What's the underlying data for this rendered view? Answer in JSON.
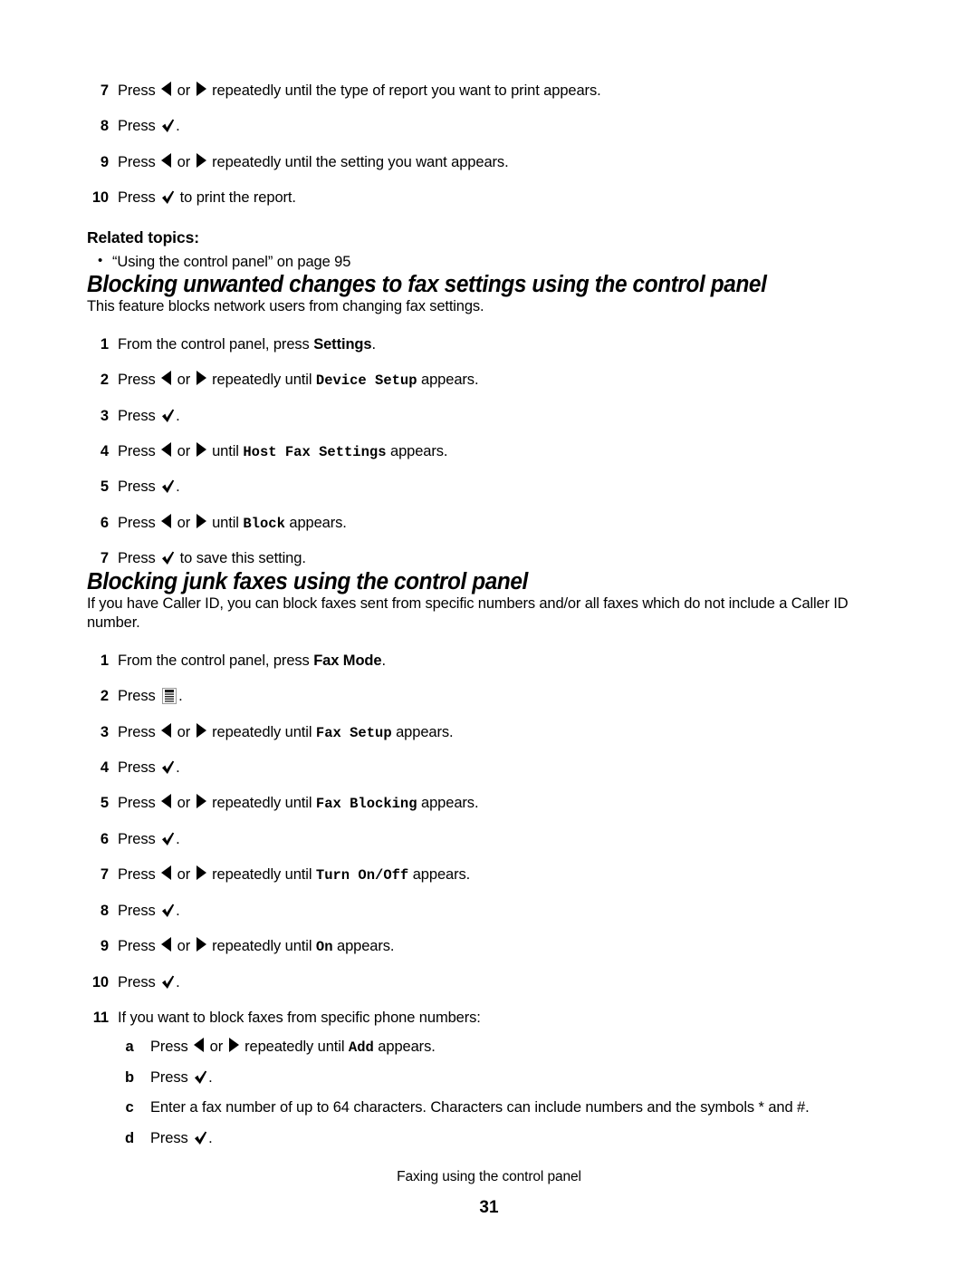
{
  "page": {
    "number": "31",
    "footer_title": "Faxing using the control panel"
  },
  "top_steps": [
    {
      "num": "7",
      "pre": "Press ",
      "mid": " or ",
      "post": " repeatedly until the type of report you want to print appears."
    },
    {
      "num": "8",
      "pre": "Press ",
      "post": "."
    },
    {
      "num": "9",
      "pre": "Press ",
      "mid": " or ",
      "post": " repeatedly until the setting you want appears."
    },
    {
      "num": "10",
      "pre": "Press ",
      "post": " to print the report."
    }
  ],
  "related": {
    "heading": "Related topics:",
    "items": [
      "“Using the control panel” on page 95"
    ]
  },
  "section_block": {
    "title": "Blocking unwanted changes to fax settings using the control panel",
    "intro": "This feature blocks network users from changing fax settings.",
    "steps": [
      {
        "num": "1",
        "pre": "From the control panel, press ",
        "strong": "Settings",
        "post": "."
      },
      {
        "num": "2",
        "pre": "Press ",
        "mid": " or ",
        "post_a": " repeatedly until ",
        "code": "Device Setup",
        "post_b": " appears."
      },
      {
        "num": "3",
        "pre": "Press ",
        "post": "."
      },
      {
        "num": "4",
        "pre": "Press ",
        "mid": " or ",
        "post_a": " until ",
        "code": "Host Fax Settings",
        "post_b": " appears."
      },
      {
        "num": "5",
        "pre": "Press ",
        "post": "."
      },
      {
        "num": "6",
        "pre": "Press ",
        "mid": " or ",
        "post_a": " until ",
        "code": "Block",
        "post_b": " appears."
      },
      {
        "num": "7",
        "pre": "Press ",
        "post": " to save this setting."
      }
    ]
  },
  "section_junk": {
    "title": "Blocking junk faxes using the control panel",
    "intro": "If you have Caller ID, you can block faxes sent from specific numbers and/or all faxes which do not include a Caller ID number.",
    "steps": [
      {
        "num": "1",
        "pre": "From the control panel, press ",
        "strong": "Fax Mode",
        "post": "."
      },
      {
        "num": "2",
        "pre": "Press ",
        "post": "."
      },
      {
        "num": "3",
        "pre": "Press ",
        "mid": " or ",
        "post_a": " repeatedly until ",
        "code": "Fax Setup",
        "post_b": " appears."
      },
      {
        "num": "4",
        "pre": "Press ",
        "post": "."
      },
      {
        "num": "5",
        "pre": "Press ",
        "mid": " or ",
        "post_a": " repeatedly until ",
        "code": "Fax Blocking",
        "post_b": " appears."
      },
      {
        "num": "6",
        "pre": "Press ",
        "post": "."
      },
      {
        "num": "7",
        "pre": "Press ",
        "mid": " or ",
        "post_a": " repeatedly until ",
        "code": "Turn On/Off",
        "post_b": " appears."
      },
      {
        "num": "8",
        "pre": "Press ",
        "post": "."
      },
      {
        "num": "9",
        "pre": "Press ",
        "mid": " or ",
        "post_a": " repeatedly until ",
        "code": "On",
        "post_b": " appears."
      },
      {
        "num": "10",
        "pre": "Press ",
        "post": "."
      },
      {
        "num": "11",
        "text": "If you want to block faxes from specific phone numbers:"
      }
    ],
    "substeps": [
      {
        "ltr": "a",
        "pre": "Press ",
        "mid": " or ",
        "post_a": " repeatedly until ",
        "code": "Add",
        "post_b": " appears."
      },
      {
        "ltr": "b",
        "pre": "Press ",
        "post": "."
      },
      {
        "ltr": "c",
        "text": "Enter a fax number of up to 64 characters. Characters can include numbers and the symbols * and #."
      },
      {
        "ltr": "d",
        "pre": "Press ",
        "post": "."
      }
    ]
  },
  "icons": {
    "left_arrow": "left-arrow-icon",
    "right_arrow": "right-arrow-icon",
    "check": "checkmark-icon",
    "menu": "menu-icon",
    "bullet": "bullet-icon"
  },
  "colors": {
    "text": "#000000",
    "background": "#ffffff"
  }
}
